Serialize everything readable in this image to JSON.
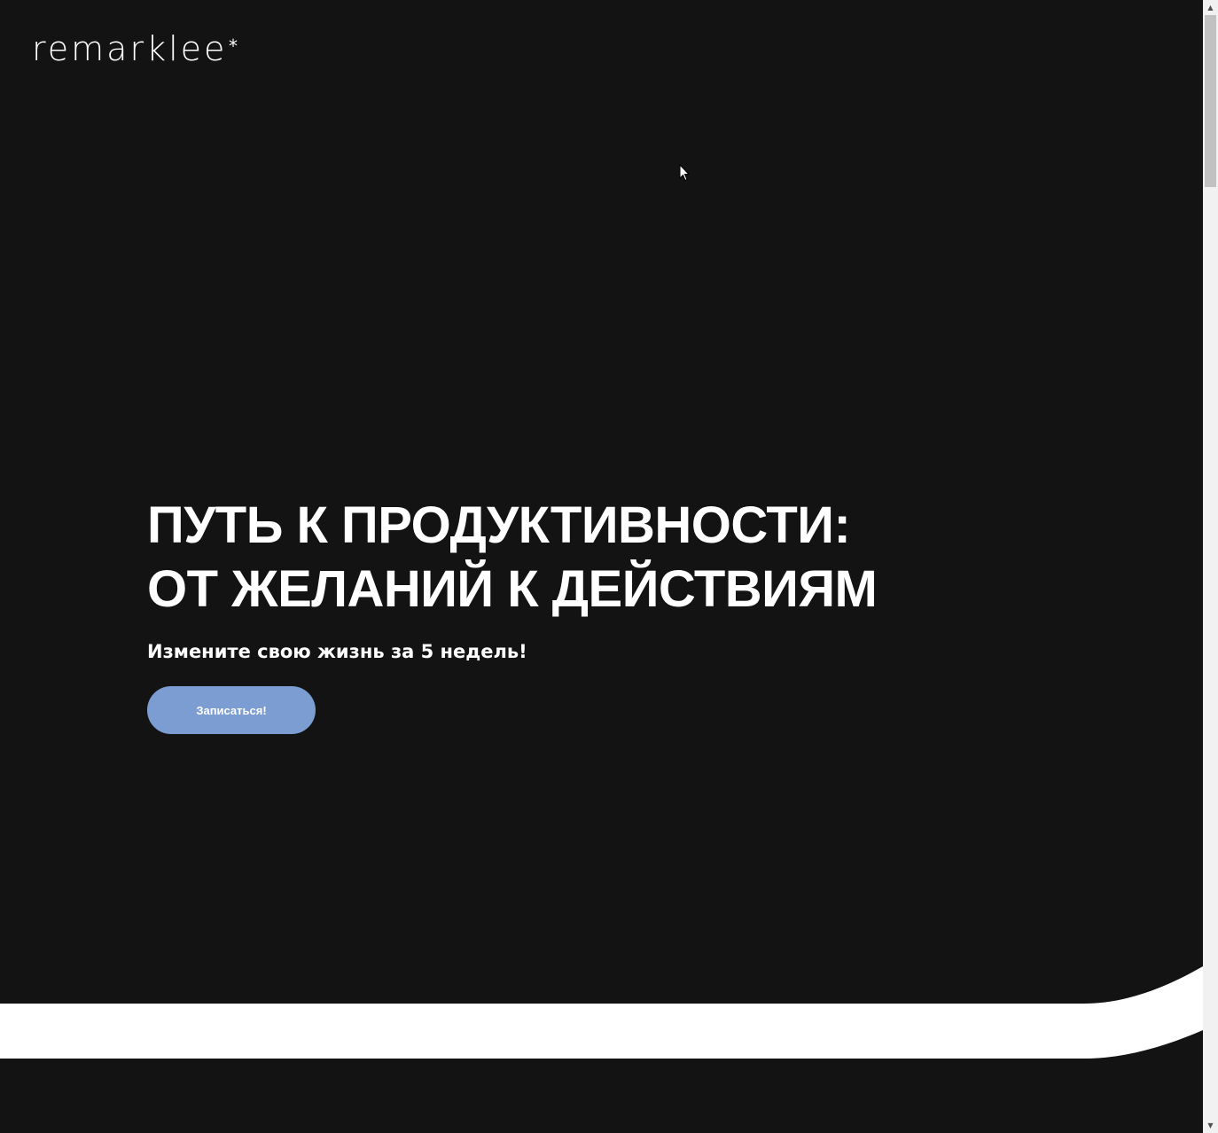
{
  "brand": {
    "logo_text": "remarklee",
    "logo_mark": "*"
  },
  "hero": {
    "title_line1": "ПУТЬ К ПРОДУКТИВНОСТИ:",
    "title_line2": "ОТ ЖЕЛАНИЙ К ДЕЙСТВИЯМ",
    "subtitle": "Измените свою жизнь за 5 недель!",
    "cta_label": "Записаться!"
  },
  "colors": {
    "background": "#131313",
    "accent": "#7b9dd1",
    "text": "#ffffff",
    "wave": "#ffffff"
  },
  "icons": {
    "cursor": "mouse-pointer-icon",
    "scroll_up": "chevron-up-icon",
    "scroll_down": "chevron-down-icon"
  }
}
